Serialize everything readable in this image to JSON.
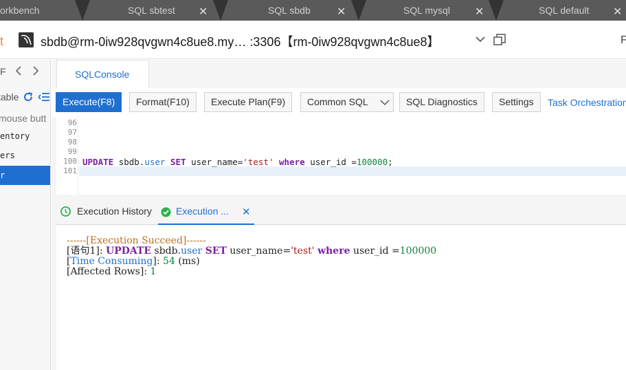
{
  "tabs": [
    {
      "label": "orkbench"
    },
    {
      "label": "SQL sbtest"
    },
    {
      "label": "SQL sbdb"
    },
    {
      "label": "SQL mysql"
    },
    {
      "label": "SQL default"
    }
  ],
  "connection": {
    "prefix": "t",
    "title": "sbdb@rm-0iw928qvgwn4c8ue8.my… :3306【rm-0iw928qvgwn4c8ue8】",
    "right_fragment": "F"
  },
  "sidebar": {
    "nav_label": "F",
    "table_label": "table",
    "hint": "mouse butt",
    "items": [
      {
        "label": "entory"
      },
      {
        "label": "ers"
      },
      {
        "label": "r"
      }
    ]
  },
  "console_tab": {
    "label": "SQLConsole"
  },
  "toolbar": {
    "execute": "Execute(F8)",
    "format": "Format(F10)",
    "execute_plan": "Execute Plan(F9)",
    "common_sql": "Common SQL",
    "diagnostics": "SQL Diagnostics",
    "settings": "Settings",
    "task_orchestration": "Task Orchestration"
  },
  "editor": {
    "line_numbers": [
      "96",
      "97",
      "98",
      "99",
      "100",
      "101"
    ],
    "code": {
      "kw_update": "UPDATE",
      "schema": "sbdb.",
      "table": "user",
      "kw_set": "SET",
      "column": "user_name=",
      "string": "'test'",
      "kw_where": "where",
      "cond": "user_id =",
      "value": "100000",
      "end": ";"
    }
  },
  "results": {
    "history_tab": "Execution History",
    "execution_tab": "Execution ...",
    "succeed_line": "------[Execution Succeed]------",
    "stmt_prefix": "[语句1]:",
    "kw_update": "UPDATE",
    "schema": "sbdb.",
    "table": "user",
    "kw_set": "SET",
    "column": "user_name=",
    "string": "'test'",
    "kw_where": "where",
    "cond": "user_id =",
    "value": "100000",
    "time_label": "Time Consuming",
    "time_value": "54",
    "time_unit": "(ms)",
    "rows_label": "Affected Rows",
    "rows_value": "1"
  },
  "colors": {
    "accent": "#1f6fd1",
    "keyword": "#7b1fa2",
    "success": "#2bb24c",
    "succeed_text": "#c0701a",
    "tab_bar": "#5a5a5a"
  }
}
